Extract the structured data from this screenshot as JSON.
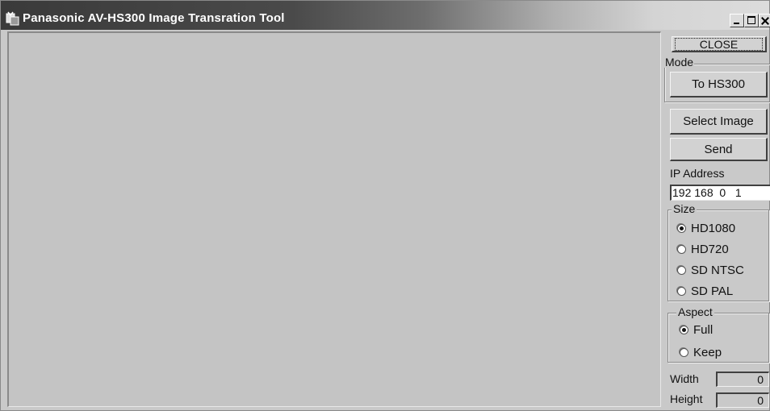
{
  "window": {
    "title": "Panasonic AV-HS300 Image Transration Tool",
    "icon": "panasonic-app-icon"
  },
  "buttons": {
    "close": "CLOSE",
    "to_hs300": "To HS300",
    "select_image": "Select Image",
    "send": "Send"
  },
  "mode": {
    "label": "Mode"
  },
  "ip": {
    "label": "IP Address",
    "value": "192 168  0   1"
  },
  "size": {
    "label": "Size",
    "options": [
      "HD1080",
      "HD720",
      "SD NTSC",
      "SD PAL"
    ],
    "selected": "HD1080"
  },
  "aspect": {
    "label": "Aspect",
    "options": [
      "Full",
      "Keep"
    ],
    "selected": "Full"
  },
  "dimensions": {
    "width_label": "Width",
    "width_value": "0",
    "height_label": "Height",
    "height_value": "0"
  }
}
